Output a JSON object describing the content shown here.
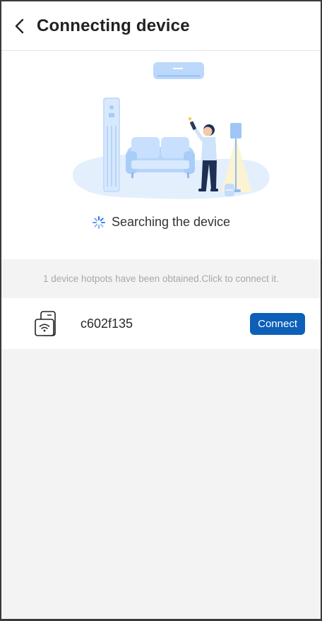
{
  "header": {
    "back_icon": "chevron-left-icon",
    "title": "Connecting device"
  },
  "hero": {
    "status_text": "Searching the device",
    "spinner_icon": "loading-spinner-icon"
  },
  "hint": {
    "text": "1 device hotpots have been obtained.Click to connect it."
  },
  "devices": [
    {
      "icon": "wifi-device-icon",
      "name": "c602f135",
      "action_label": "Connect"
    }
  ],
  "colors": {
    "accent": "#0d5fb8",
    "background": "#f3f3f3",
    "illustration_blue": "#c9e0fb"
  }
}
